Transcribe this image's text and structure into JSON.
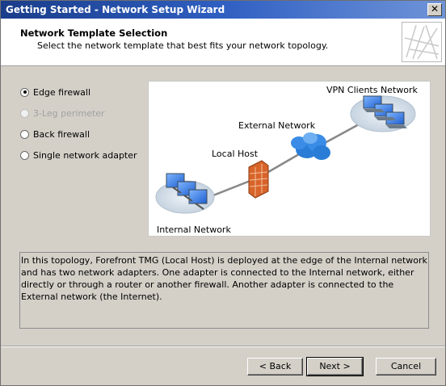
{
  "window": {
    "title": "Getting Started - Network Setup Wizard",
    "close_glyph": "✕"
  },
  "header": {
    "title": "Network Template Selection",
    "subtitle": "Select the network template that best fits your network topology."
  },
  "options": [
    {
      "label": "Edge firewall",
      "checked": true,
      "enabled": true
    },
    {
      "label": "3-Leg perimeter",
      "checked": false,
      "enabled": false
    },
    {
      "label": "Back firewall",
      "checked": false,
      "enabled": true
    },
    {
      "label": "Single network adapter",
      "checked": false,
      "enabled": true
    }
  ],
  "diagram": {
    "vpn_label": "VPN Clients Network",
    "external_label": "External Network",
    "localhost_label": "Local Host",
    "internal_label": "Internal Network"
  },
  "description": "In this topology, Forefront TMG (Local Host) is deployed at the edge of the Internal network and has two network adapters. One adapter is connected to the Internal network, either directly or through a router or another firewall. Another adapter is connected to the External network (the Internet).",
  "buttons": {
    "back": "< Back",
    "next": "Next >",
    "cancel": "Cancel"
  },
  "colors": {
    "titlebar": "#2f5fc2",
    "cloud": "#2a7dd6",
    "firewall": "#d8642a",
    "monitor": "#2d6fd6"
  }
}
